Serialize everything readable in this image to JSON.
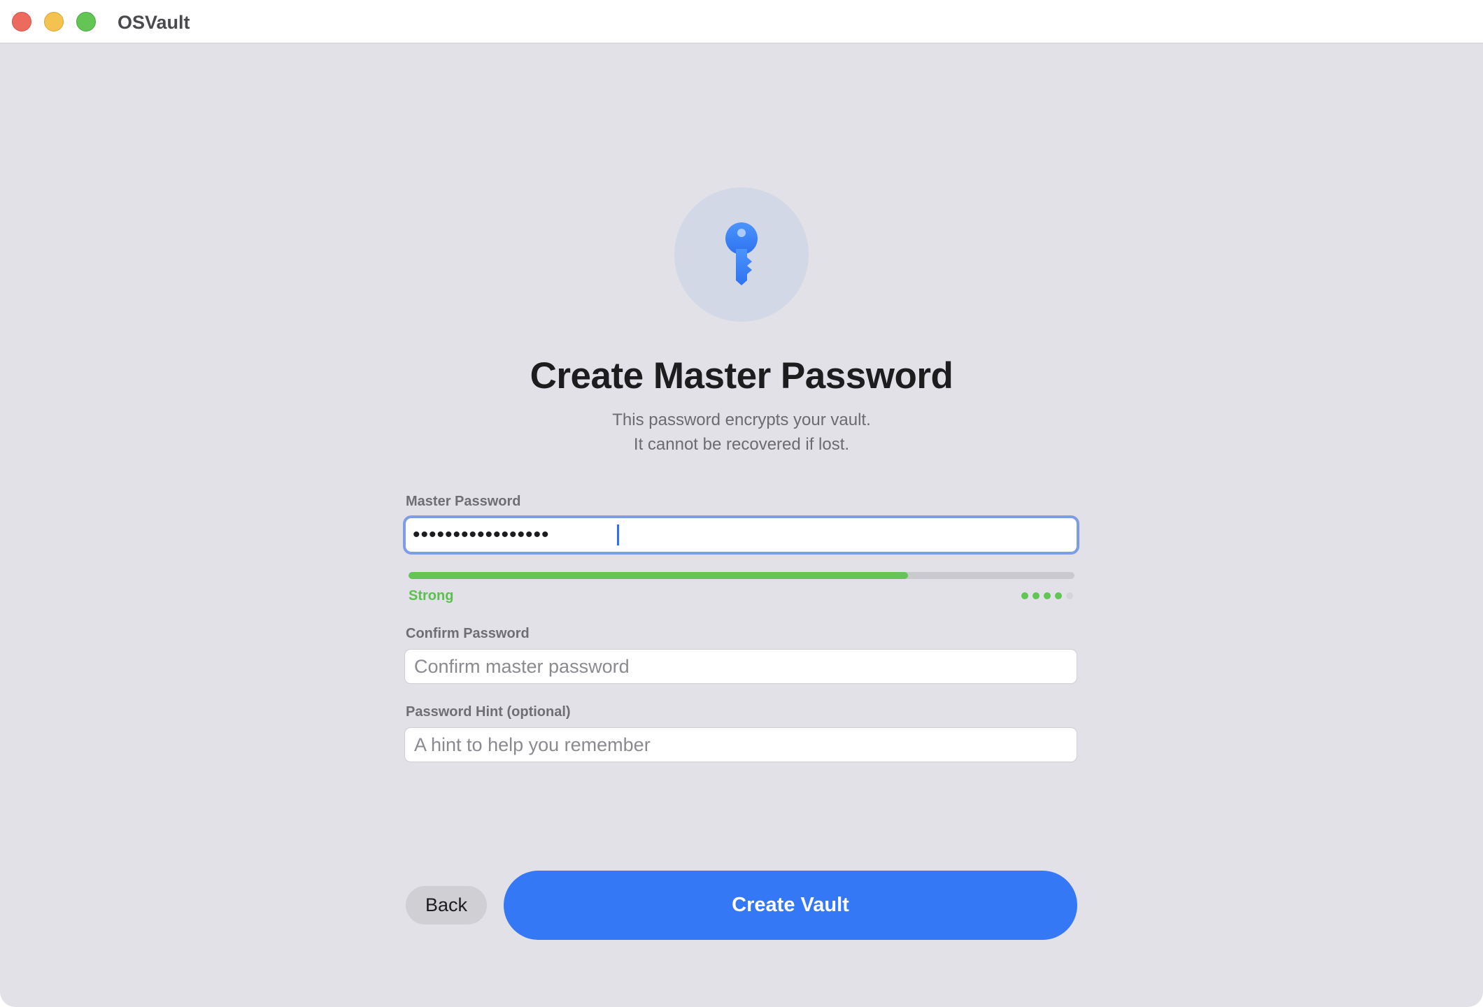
{
  "window": {
    "app_title": "OSVault"
  },
  "header": {
    "icon": "key-icon",
    "title": "Create Master Password",
    "subtitle_line1": "This password encrypts your vault.",
    "subtitle_line2": "It cannot be recovered if lost."
  },
  "form": {
    "master_password": {
      "label": "Master Password",
      "value": "•••••••••••••••••",
      "focused": true
    },
    "strength": {
      "label": "Strong",
      "level": 0.75,
      "dots_filled": 4,
      "dots_total": 5,
      "color": "#62c554"
    },
    "confirm_password": {
      "label": "Confirm Password",
      "placeholder": "Confirm master password",
      "value": ""
    },
    "hint": {
      "label": "Password Hint (optional)",
      "placeholder": "A hint to help you remember",
      "value": ""
    }
  },
  "actions": {
    "back_label": "Back",
    "create_label": "Create Vault",
    "accent_color": "#3478f6"
  }
}
